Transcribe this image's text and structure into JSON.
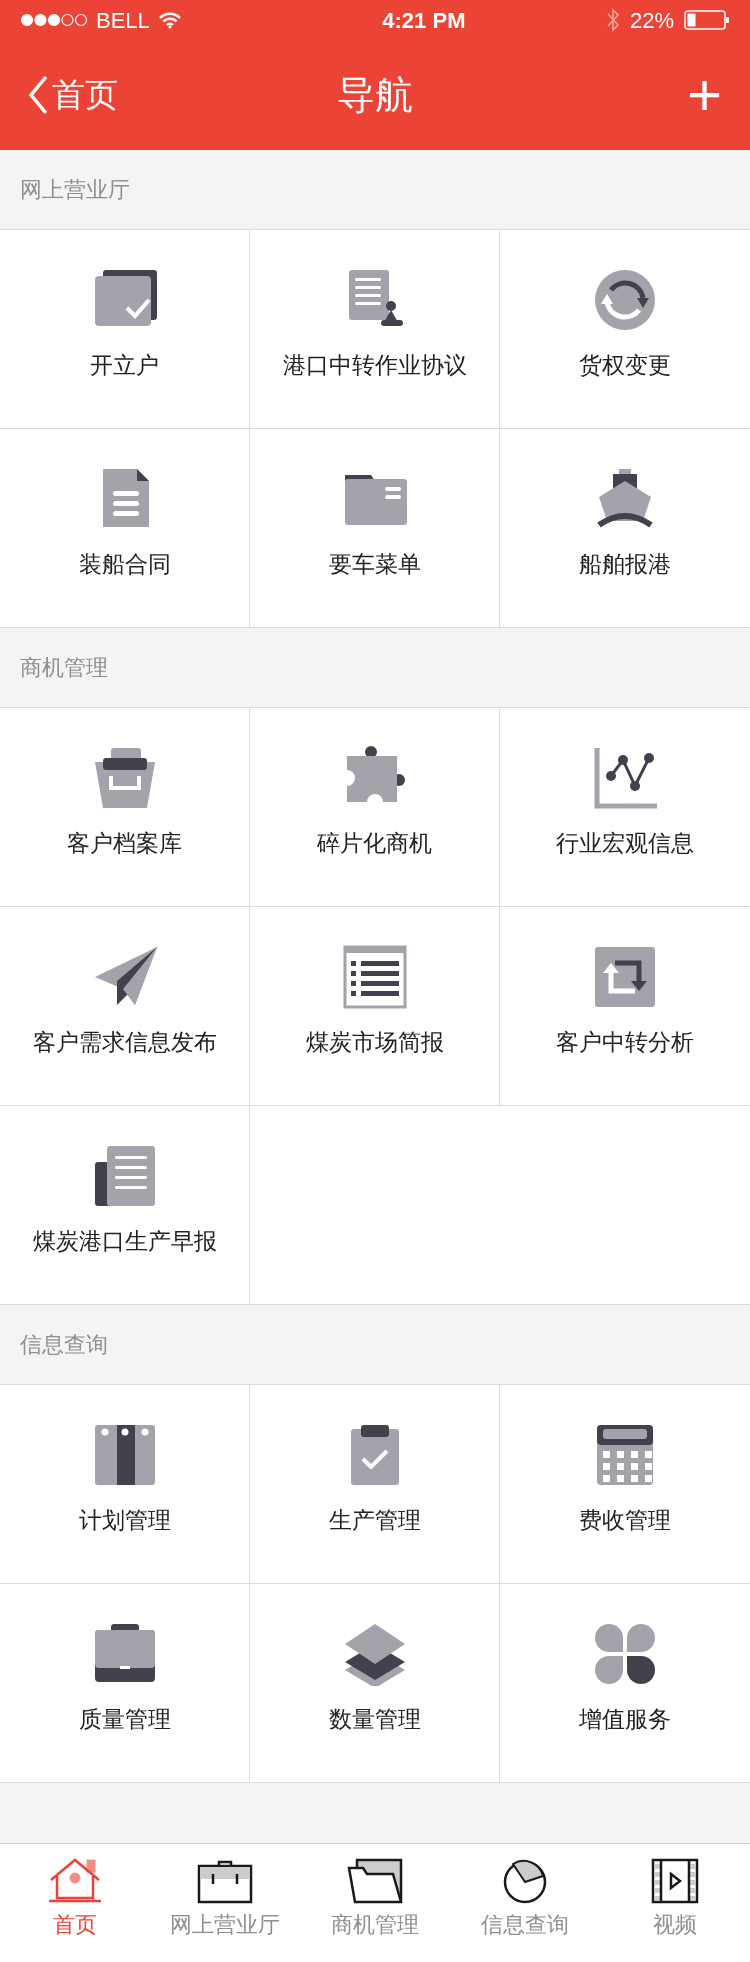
{
  "status_bar": {
    "carrier": "BELL",
    "time": "4:21 PM",
    "battery": "22%"
  },
  "nav": {
    "back": "首页",
    "title": "导航",
    "add": "+"
  },
  "sections": [
    {
      "title": "网上营业厅",
      "items": [
        "开立户",
        "港口中转作业协议",
        "货权变更",
        "装船合同",
        "要车菜单",
        "船舶报港"
      ]
    },
    {
      "title": "商机管理",
      "items": [
        "客户档案库",
        "碎片化商机",
        "行业宏观信息",
        "客户需求信息发布",
        "煤炭市场简报",
        "客户中转分析",
        "煤炭港口生产早报"
      ]
    },
    {
      "title": "信息查询",
      "items": [
        "计划管理",
        "生产管理",
        "费收管理",
        "质量管理",
        "数量管理",
        "增值服务"
      ]
    }
  ],
  "tab_bar": [
    {
      "label": "首页",
      "selected": true
    },
    {
      "label": "网上营业厅",
      "selected": false
    },
    {
      "label": "商机管理",
      "selected": false
    },
    {
      "label": "信息查询",
      "selected": false
    },
    {
      "label": "视频",
      "selected": false
    }
  ]
}
